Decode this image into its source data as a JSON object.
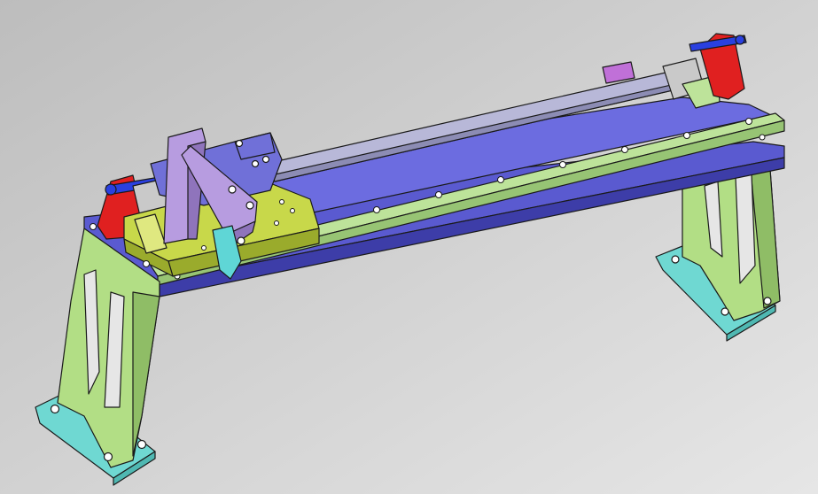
{
  "scene": {
    "colors": {
      "bg_top": "#bdbdbd",
      "bg_bottom": "#e6e6e6",
      "outline": "#1a1a1a",
      "leg": "#b2de85",
      "leg_shade": "#8fbd66",
      "foot": "#6fd8d2",
      "foot_shade": "#4fb8b2",
      "base_plate": "#5a5ad0",
      "base_side": "#3d3da8",
      "top_plate": "#6c6ce0",
      "rail": "#bde39a",
      "rail_shade": "#97c474",
      "rod": "#b8b8d8",
      "rod_shade": "#8c8cb4",
      "bracket": "#e02020",
      "screw": "#2a40e0",
      "carriage": "#c8d84a",
      "carriage_shade": "#9aab2c",
      "block": "#7070d8",
      "arm": "#b79ce0",
      "arm_shade": "#8f74bc",
      "clamp": "#5fd6d6",
      "end_stop": "#c070d8",
      "collar": "#c9c9c9"
    },
    "icons": [
      "left-leg-icon",
      "right-leg-icon",
      "linear-rail-icon",
      "guide-rod-icon",
      "bracket-icon",
      "screw-icon",
      "carriage-icon",
      "arm-icon",
      "clamp-icon"
    ]
  }
}
